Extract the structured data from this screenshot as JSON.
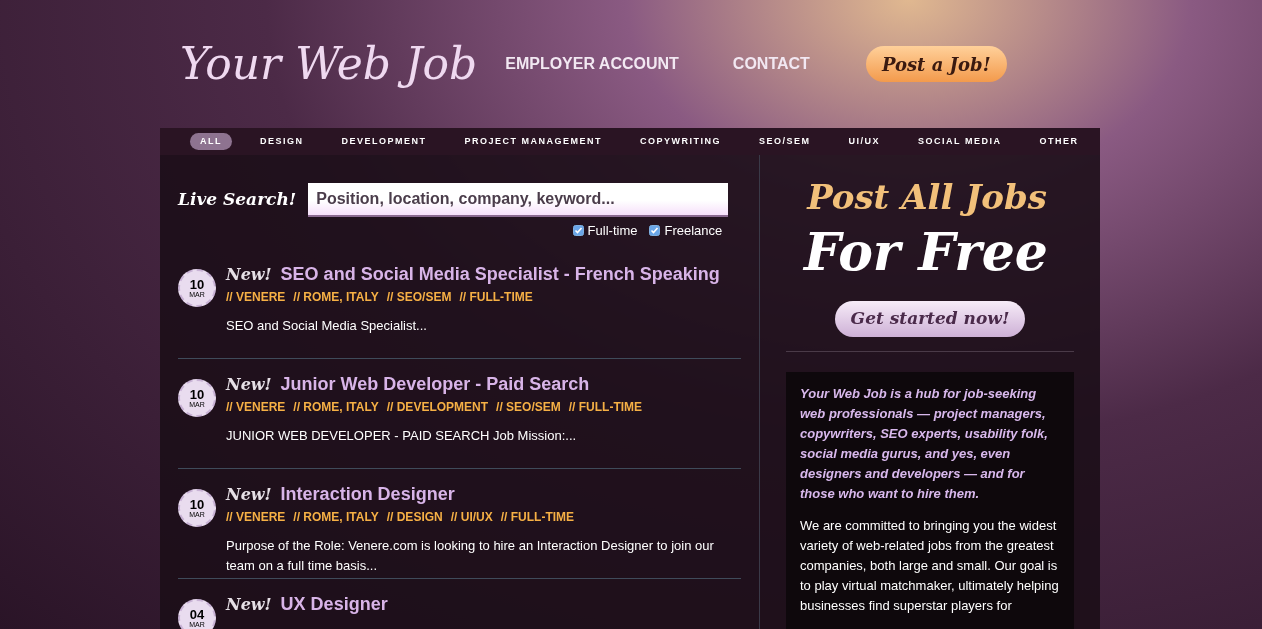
{
  "header": {
    "logo": "Your Web Job",
    "nav": [
      "EMPLOYER ACCOUNT",
      "CONTACT"
    ],
    "post_button": "Post a Job!"
  },
  "categories": [
    {
      "label": "ALL",
      "selected": true
    },
    {
      "label": "DESIGN",
      "selected": false
    },
    {
      "label": "DEVELOPMENT",
      "selected": false
    },
    {
      "label": "PROJECT MANAGEMENT",
      "selected": false
    },
    {
      "label": "COPYWRITING",
      "selected": false
    },
    {
      "label": "SEO/SEM",
      "selected": false
    },
    {
      "label": "UI/UX",
      "selected": false
    },
    {
      "label": "SOCIAL MEDIA",
      "selected": false
    },
    {
      "label": "OTHER",
      "selected": false
    }
  ],
  "search": {
    "label": "Live Search!",
    "placeholder": "Position, location, company, keyword...",
    "filters": [
      {
        "label": "Full-time",
        "checked": true
      },
      {
        "label": "Freelance",
        "checked": true
      }
    ]
  },
  "jobs": [
    {
      "day": "10",
      "month": "MAR",
      "badge": "New!",
      "title": "SEO and Social Media Specialist - French Speaking",
      "meta": [
        "// VENERE",
        "// ROME, ITALY",
        "// SEO/SEM",
        "// FULL-TIME"
      ],
      "summary": "SEO and Social Media Specialist..."
    },
    {
      "day": "10",
      "month": "MAR",
      "badge": "New!",
      "title": "Junior Web Developer - Paid Search",
      "meta": [
        "// VENERE",
        "// ROME, ITALY",
        "// DEVELOPMENT",
        "// SEO/SEM",
        "// FULL-TIME"
      ],
      "summary": "JUNIOR WEB DEVELOPER - PAID SEARCH Job Mission:..."
    },
    {
      "day": "10",
      "month": "MAR",
      "badge": "New!",
      "title": "Interaction Designer",
      "meta": [
        "// VENERE",
        "// ROME, ITALY",
        "// DESIGN",
        "// UI/UX",
        "// FULL-TIME"
      ],
      "summary": "Purpose of the Role: Venere.com is looking to hire an Interaction Designer to join our team on a full time basis..."
    },
    {
      "day": "04",
      "month": "MAR",
      "badge": "New!",
      "title": "UX Designer"
    }
  ],
  "promo": {
    "line_1": "Post All Jobs",
    "line_2": "For Free",
    "button": "Get started now!"
  },
  "about": {
    "intro": "Your Web Job is a hub for job-seeking web professionals — project managers, copywriters, SEO experts, usability folk, social media gurus, and yes, even designers and developers — and for those who want to hire them.",
    "body": "We are committed to bringing you the widest variety of web-related jobs from the greatest companies, both large and small. Our goal is to play virtual matchmaker, ultimately helping businesses find superstar players for"
  }
}
